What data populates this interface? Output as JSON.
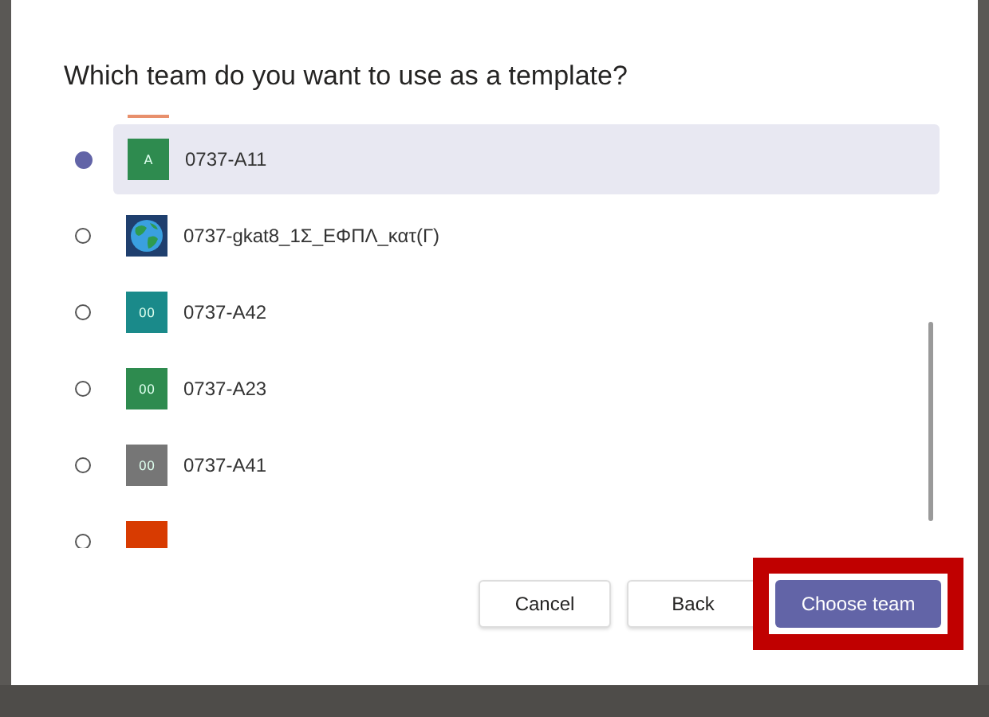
{
  "dialog": {
    "title": "Which team do you want to use as a template?"
  },
  "teams": [
    {
      "name": "0737-A11",
      "initials": "A",
      "color": "#2e8b4f",
      "selected": true,
      "kind": "initials"
    },
    {
      "name": "0737-gkat8_1Σ_ΕΦΠΛ_κατ(Γ)",
      "color": "#1f3f6e",
      "selected": false,
      "kind": "globe"
    },
    {
      "name": "0737-A42",
      "initials": "00",
      "color": "#1a8a8a",
      "selected": false,
      "kind": "initials"
    },
    {
      "name": "0737-A23",
      "initials": "00",
      "color": "#2e8b4f",
      "selected": false,
      "kind": "initials"
    },
    {
      "name": "0737-A41",
      "initials": "00",
      "color": "#767676",
      "selected": false,
      "kind": "initials"
    },
    {
      "color": "#d83b01",
      "selected": false,
      "kind": "blank"
    }
  ],
  "buttons": [
    {
      "label": "Cancel",
      "kind": "secondary"
    },
    {
      "label": "Back",
      "kind": "secondary"
    },
    {
      "label": "Choose team",
      "kind": "primary",
      "highlighted": true
    }
  ]
}
